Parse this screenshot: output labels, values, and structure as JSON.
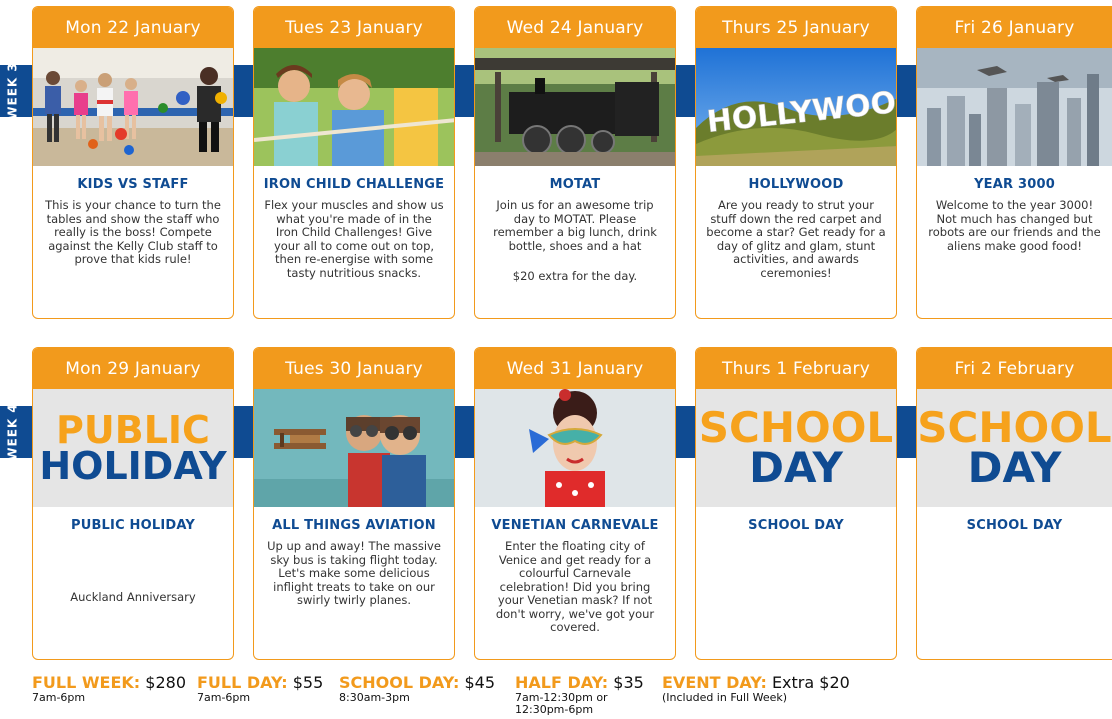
{
  "weeks": [
    {
      "label": "WEEK 3"
    },
    {
      "label": "WEEK 4"
    }
  ],
  "row1": [
    {
      "date": "Mon 22 January",
      "title": "KIDS VS STAFF",
      "body": "This is your chance to turn the tables and show the staff who really is the boss! Compete against the Kelly Club staff to prove that kids rule!",
      "extra": "",
      "image": "gym-kids"
    },
    {
      "date": "Tues 23 January",
      "title": "IRON CHILD CHALLENGE",
      "body": "Flex your muscles and show us what you're made of in the Iron Child Challenges! Give your all to come out on top, then re-energise with some tasty nutritious snacks.",
      "extra": "",
      "image": "tug-of-war"
    },
    {
      "date": "Wed 24 January",
      "title": "MOTAT",
      "body": "Join us for an awesome trip day to MOTAT. Please remember a big lunch, drink bottle, shoes and a hat",
      "extra": "$20 extra for the day.",
      "image": "steam-train"
    },
    {
      "date": "Thurs 25 January",
      "title": "HOLLYWOOD",
      "body": "Are you ready to strut your stuff down the red carpet and become a star? Get ready for a day of glitz and glam, stunt activities, and awards ceremonies!",
      "extra": "",
      "image": "hollywood-sign"
    },
    {
      "date": "Fri 26 January",
      "title": "YEAR 3000",
      "body": "Welcome to the year 3000! Not much has changed but robots are our friends and the aliens make good food!",
      "extra": "",
      "image": "future-city"
    }
  ],
  "row2": [
    {
      "date": "Mon 29 January",
      "title": "PUBLIC HOLIDAY",
      "big1": "PUBLIC",
      "big2": "HOLIDAY",
      "body": "",
      "note": "Auckland Anniversary",
      "image": "text-panel"
    },
    {
      "date": "Tues 30 January",
      "title": "ALL THINGS AVIATION",
      "body": "Up up and away! The massive sky bus is taking flight today. Let's make some delicious inflight treats to take on our swirly twirly planes.",
      "image": "aviation-kids"
    },
    {
      "date": "Wed 31 January",
      "title": "VENETIAN CARNEVALE",
      "body": "Enter the floating city of Venice and get ready for a colourful Carnevale celebration! Did you bring your Venetian mask? If not don't worry, we've got your covered.",
      "image": "masked-girl"
    },
    {
      "date": "Thurs 1 February",
      "title": "SCHOOL DAY",
      "big1": "SCHOOL",
      "big2": "DAY",
      "body": "",
      "image": "text-panel"
    },
    {
      "date": "Fri 2 February",
      "title": "SCHOOL DAY",
      "big1": "SCHOOL",
      "big2": "DAY",
      "body": "",
      "image": "text-panel"
    }
  ],
  "pricing": [
    {
      "label": "FULL WEEK:",
      "amount": "$280",
      "sub1": "7am-6pm",
      "sub2": ""
    },
    {
      "label": "FULL DAY:",
      "amount": "$55",
      "sub1": "7am-6pm",
      "sub2": ""
    },
    {
      "label": "SCHOOL DAY:",
      "amount": "$45",
      "sub1": "8:30am-3pm",
      "sub2": ""
    },
    {
      "label": "HALF DAY:",
      "amount": "$35",
      "sub1": "7am-12:30pm or",
      "sub2": "12:30pm-6pm"
    },
    {
      "label": "EVENT DAY:",
      "amount": "Extra $20",
      "sub1": "(Included in Full Week)",
      "sub2": ""
    }
  ],
  "colors": {
    "orange": "#f29a1c",
    "navy": "#0f4b92"
  }
}
